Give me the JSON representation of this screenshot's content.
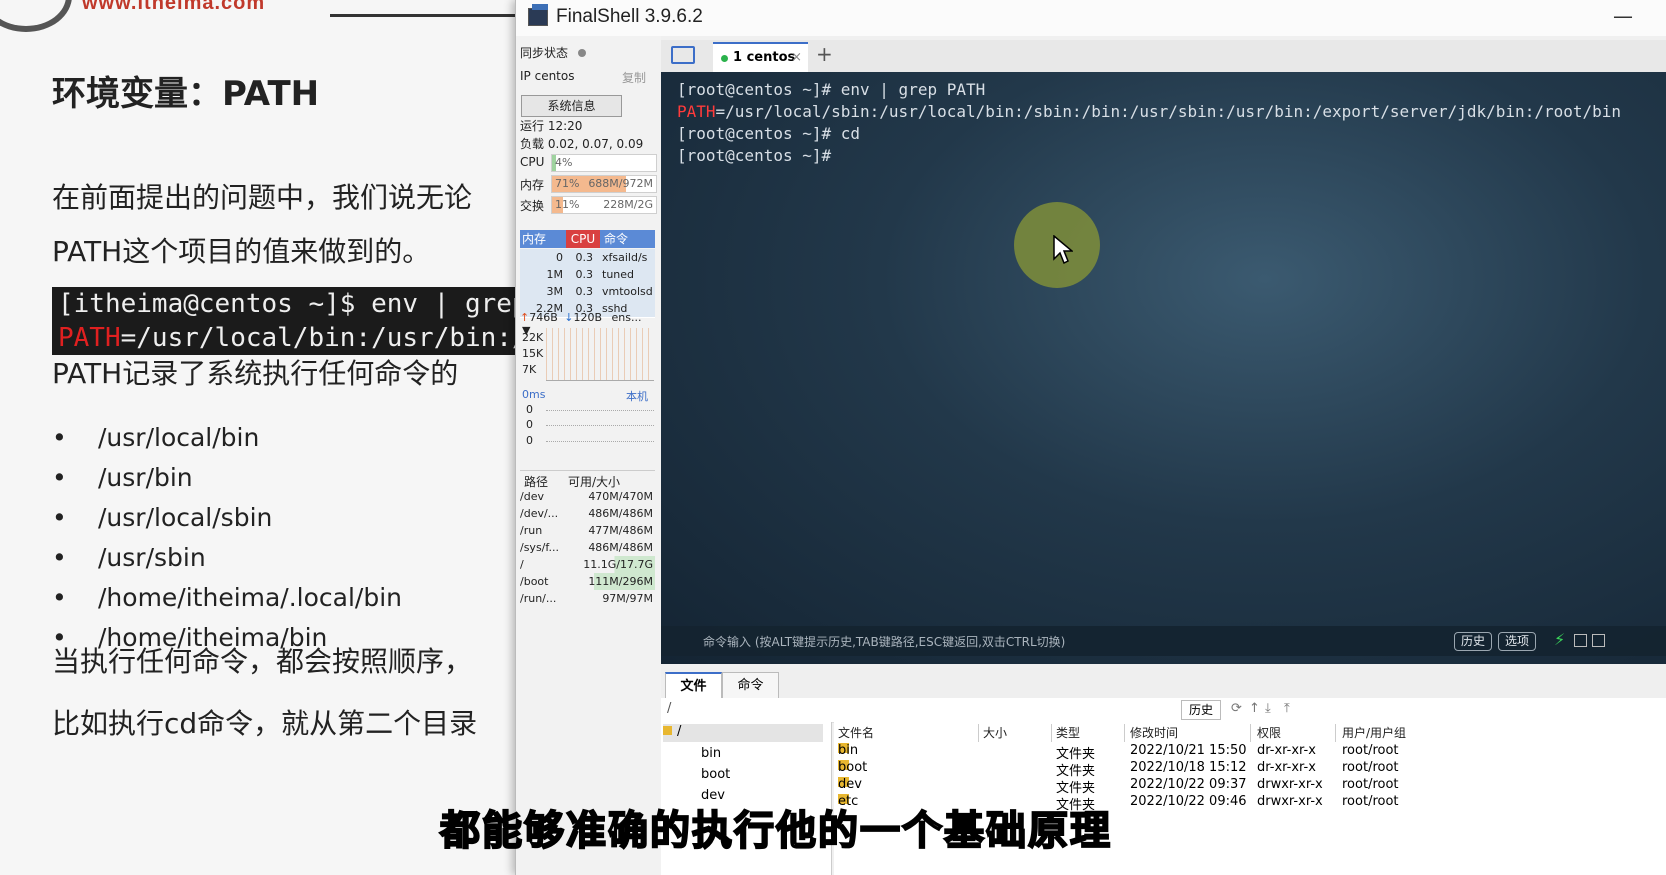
{
  "slide": {
    "logo_url": "www.itheima.com",
    "title": "环境变量：PATH",
    "para1": "在前面提出的问题中，我们说无论",
    "para2": "PATH这个项目的值来做到的。",
    "code_line1": "[itheima@centos ~]$ env | grep",
    "code_line2_key": "PATH",
    "code_line2_rest": "=/usr/local/bin:/usr/bin:/u",
    "para3": "PATH记录了系统执行任何命令的",
    "bullets": [
      "/usr/local/bin",
      "/usr/bin",
      "/usr/local/sbin",
      "/usr/sbin",
      "/home/itheima/.local/bin",
      "/home/itheima/bin"
    ],
    "bullet_char": "•",
    "para4": "当执行任何命令，都会按照顺序，",
    "para5": "比如执行cd命令，就从第二个目录"
  },
  "window": {
    "title": "FinalShell 3.9.6.2",
    "minimize": "—"
  },
  "sidebar": {
    "sync_label": "同步状态",
    "ip_label": "IP centos",
    "copy_label": "复制",
    "sysinfo_button": "系统信息",
    "uptime": "运行 12:20",
    "load": "负载 0.02, 0.07, 0.09",
    "cpu_label": "CPU",
    "cpu_value": "4%",
    "cpu_fraction": 0.04,
    "mem_label": "内存",
    "mem_percent": "71%",
    "mem_value": "688M/972M",
    "mem_fraction": 0.71,
    "swap_label": "交换",
    "swap_percent": "11%",
    "swap_value": "228M/2G",
    "swap_fraction": 0.11,
    "proc_headers": [
      "内存",
      "CPU",
      "命令"
    ],
    "processes": [
      {
        "mem": "0",
        "cpu": "0.3",
        "cmd": "xfsaild/s"
      },
      {
        "mem": "1M",
        "cpu": "0.3",
        "cmd": "tuned"
      },
      {
        "mem": "3M",
        "cpu": "0.3",
        "cmd": "vmtoolsd"
      },
      {
        "mem": "2.2M",
        "cpu": "0.3",
        "cmd": "sshd"
      }
    ],
    "net_up": "746B",
    "net_down": "120B",
    "net_iface": "ens...",
    "net_scale": [
      "22K",
      "15K",
      "7K"
    ],
    "latency_label": "0ms",
    "latency_host": "本机",
    "latency_values": [
      "0",
      "0",
      "0"
    ],
    "disk_headers": [
      "路径",
      "可用/大小"
    ],
    "disks": [
      {
        "path": "/dev",
        "size": "470M/470M"
      },
      {
        "path": "/dev/...",
        "size": "486M/486M"
      },
      {
        "path": "/run",
        "size": "477M/486M"
      },
      {
        "path": "/sys/f...",
        "size": "486M/486M"
      },
      {
        "path": "/",
        "size": "11.1G/17.7G"
      },
      {
        "path": "/boot",
        "size": "111M/296M"
      },
      {
        "path": "/run/...",
        "size": "97M/97M"
      }
    ]
  },
  "tabs": {
    "session_label": "1 centos",
    "close": "×",
    "add": "+"
  },
  "terminal": {
    "line1": "[root@centos ~]# env | grep PATH",
    "line2_key": "PATH",
    "line2_rest": "=/usr/local/sbin:/usr/local/bin:/sbin:/bin:/usr/sbin:/usr/bin:/export/server/jdk/bin:/root/bin",
    "line3": "[root@centos ~]# cd",
    "line4": "[root@centos ~]#"
  },
  "cmdbar": {
    "hint": "命令输入 (按ALT键提示历史,TAB键路径,ESC键返回,双击CTRL切换)",
    "history_button": "历史",
    "options_button": "选项"
  },
  "files": {
    "tab_files": "文件",
    "tab_commands": "命令",
    "path": "/",
    "history_button": "历史",
    "tree_root": "/",
    "tree_items": [
      "bin",
      "boot",
      "dev"
    ],
    "columns": [
      "文件名",
      "大小",
      "类型",
      "修改时间",
      "权限",
      "用户/用户组"
    ],
    "rows": [
      {
        "name": "bin",
        "size": "",
        "type": "文件夹",
        "mtime": "2022/10/21 15:50",
        "perm": "dr-xr-xr-x",
        "owner": "root/root"
      },
      {
        "name": "boot",
        "size": "",
        "type": "文件夹",
        "mtime": "2022/10/18 15:12",
        "perm": "dr-xr-xr-x",
        "owner": "root/root"
      },
      {
        "name": "dev",
        "size": "",
        "type": "文件夹",
        "mtime": "2022/10/22 09:37",
        "perm": "drwxr-xr-x",
        "owner": "root/root"
      },
      {
        "name": "etc",
        "size": "",
        "type": "文件夹",
        "mtime": "2022/10/22 09:46",
        "perm": "drwxr-xr-x",
        "owner": "root/root"
      }
    ]
  },
  "subtitle": "都能够准确的执行他的一个基础原理"
}
